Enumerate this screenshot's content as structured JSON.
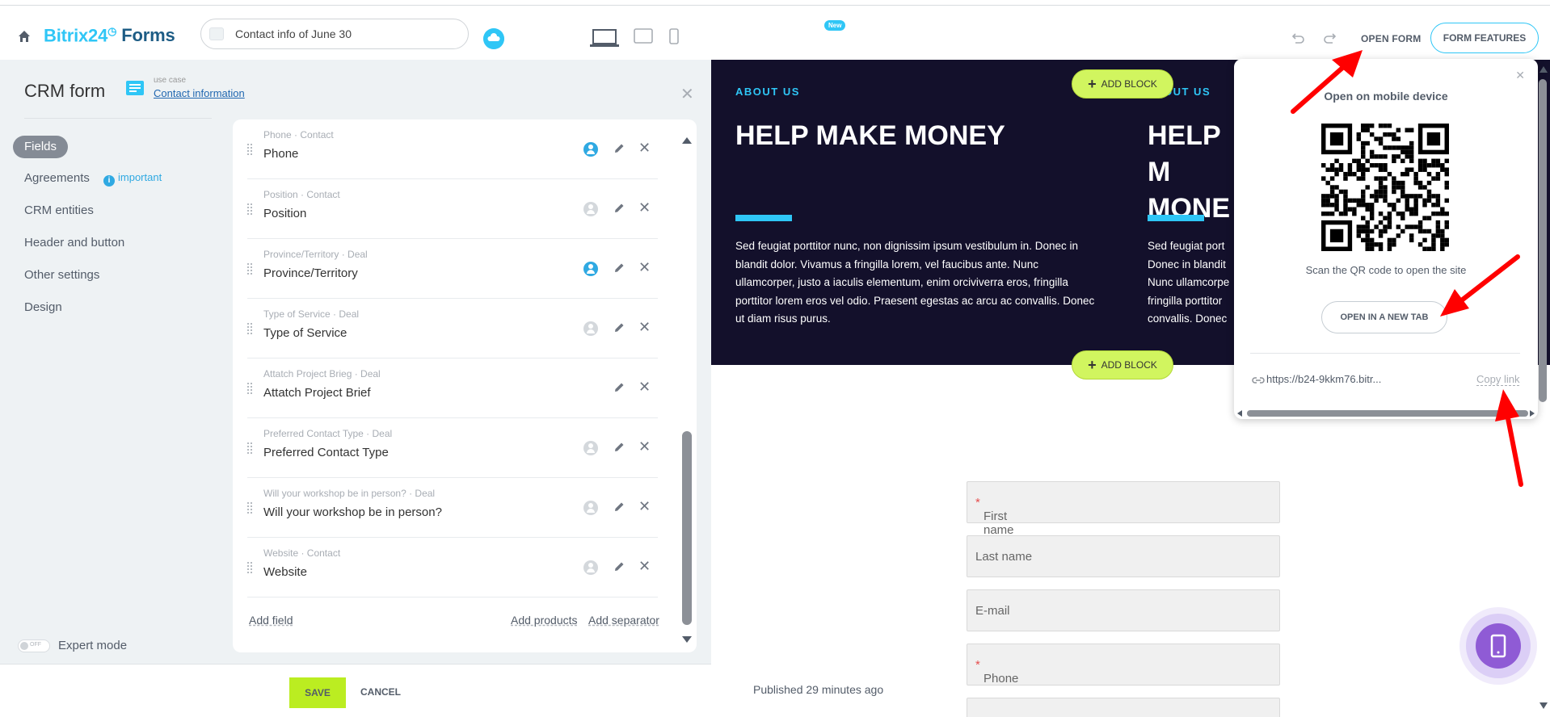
{
  "topbar": {
    "logo_main": "Bitrix24",
    "logo_clock": "◷",
    "logo_product": "Forms",
    "form_title_value": "Contact info of June 30",
    "new_badge": "New",
    "open_form_label": "OPEN FORM",
    "form_features_label": "FORM FEATURES"
  },
  "panel": {
    "title": "CRM form",
    "usecase_label": "use case",
    "usecase_link": "Contact information",
    "nav": [
      {
        "label": "Fields",
        "active": true
      },
      {
        "label": "Agreements"
      },
      {
        "label": "CRM entities"
      },
      {
        "label": "Header and button"
      },
      {
        "label": "Other settings"
      },
      {
        "label": "Design"
      }
    ],
    "important_label": "important",
    "expert_toggle_text": "OFF",
    "expert_mode_label": "Expert mode"
  },
  "fields": [
    {
      "meta": "Phone · Contact",
      "name": "Phone",
      "linked": true
    },
    {
      "meta": "Position · Contact",
      "name": "Position",
      "linked": false
    },
    {
      "meta": "Province/Territory · Deal",
      "name": "Province/Territory",
      "linked": true
    },
    {
      "meta": "Type of Service · Deal",
      "name": "Type of Service",
      "linked": false
    },
    {
      "meta": "Attatch Project Brieg · Deal",
      "name": "Attatch Project Brief",
      "linked": null
    },
    {
      "meta": "Preferred Contact Type · Deal",
      "name": "Preferred Contact Type",
      "linked": false
    },
    {
      "meta": "Will your workshop be in person? · Deal",
      "name": "Will your workshop be in person?",
      "linked": false
    },
    {
      "meta": "Website · Contact",
      "name": "Website",
      "linked": false
    }
  ],
  "field_actions": {
    "add_field": "Add field",
    "add_products": "Add products",
    "add_separator": "Add separator"
  },
  "footer": {
    "save_label": "SAVE",
    "cancel_label": "CANCEL"
  },
  "preview": {
    "about_label": "ABOUT US",
    "about_label_clipped": "OUT US",
    "hero_title": "HELP MAKE MONEY",
    "hero_title_clipped": "HELP M MONE",
    "hero_text": "Sed feugiat porttitor nunc, non dignissim ipsum vestibulum in. Donec in blandit dolor. Vivamus a fringilla lorem, vel faucibus ante. Nunc ullamcorper, justo a iaculis elementum, enim orciviverra eros, fringilla porttitor lorem eros vel odio. Praesent egestas ac arcu ac convallis. Donec ut diam risus purus.",
    "hero_text_clipped": "Sed feugiat port Donec in blandit Nunc ullamcorpe fringilla porttitor convallis. Donec",
    "add_block_label": "ADD BLOCK",
    "form_fields": [
      {
        "label": "First name",
        "required": true
      },
      {
        "label": "Last name",
        "required": false
      },
      {
        "label": "E-mail",
        "required": false
      },
      {
        "label": "Phone",
        "required": true
      }
    ],
    "required_mark": "*",
    "published_text": "Published 29 minutes ago"
  },
  "popup": {
    "title": "Open on mobile device",
    "scan_text": "Scan the QR code to open the site",
    "open_tab_label": "OPEN IN A NEW TAB",
    "url": "https://b24-9kkm76.bitr...",
    "copy_link": "Copy link"
  },
  "colors": {
    "accent": "#2fc6f6",
    "save": "#bbed21",
    "hero_bg": "#13102b",
    "add_block": "#d1f55f",
    "arrow": "#ff0000"
  }
}
